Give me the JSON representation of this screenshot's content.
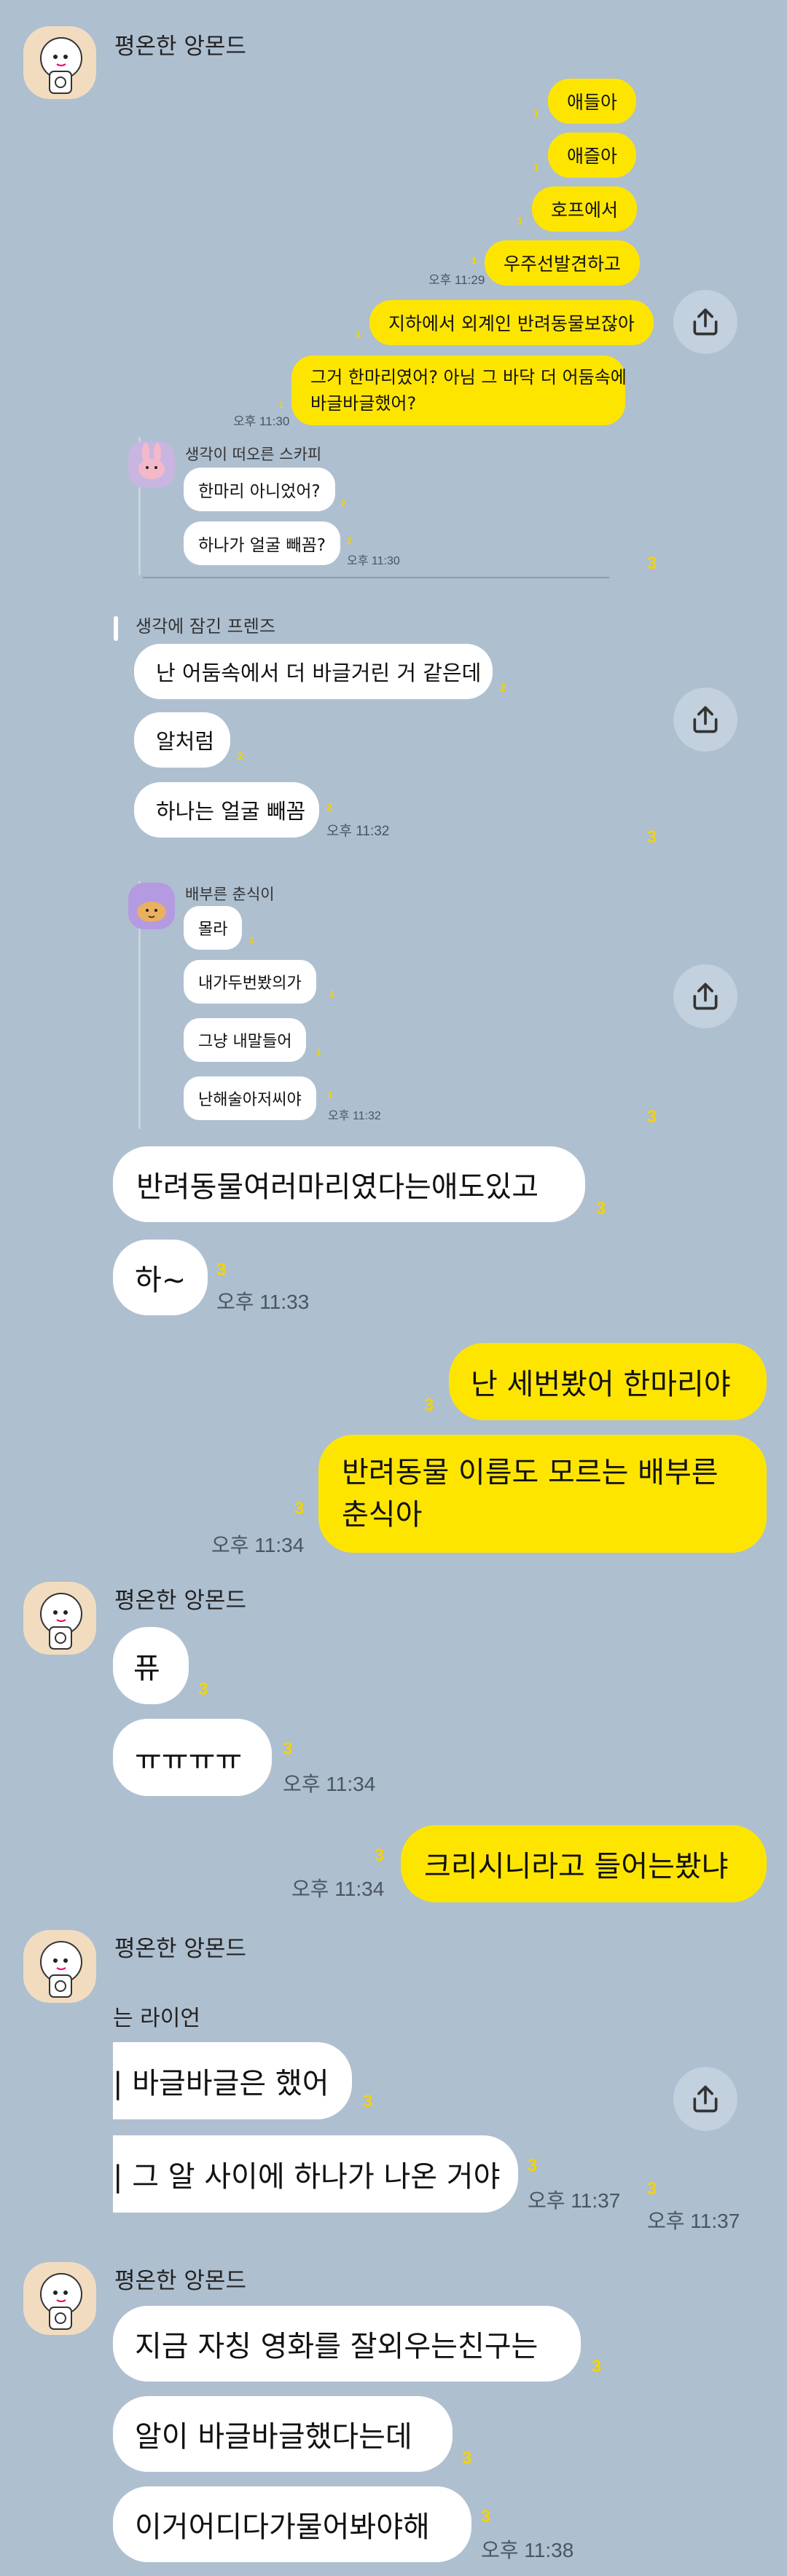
{
  "colors": {
    "background": "#aebfd0",
    "my_bubble": "#fee500",
    "their_bubble": "#ffffff",
    "unread_count": "#f4d300"
  },
  "shot1": {
    "sender": "평온한 앙몬드",
    "my_msgs": [
      "애들아",
      "애즐아",
      "호프에서",
      "우주선발견하고",
      "지하에서 외계인 반려동물보잖아",
      "그거 한마리였어? 아님 그 바닥 더 어둠속에",
      "바글바글했어?"
    ],
    "my_counts": [
      "1",
      "1",
      "1",
      "1",
      "1",
      "1"
    ],
    "time_a": "오후 11:29",
    "time_b": "오후 11:30",
    "q_sender": "생각이 떠오른 스카피",
    "q_msgs": [
      "한마리 아니었어?",
      "하나가 얼굴 빼꼼?"
    ],
    "q_counts": [
      "2",
      "2"
    ],
    "q_time": "오후 11:30",
    "count": "3"
  },
  "shot2": {
    "sender": "생각에 잠긴 프렌즈",
    "msgs": [
      "난 어둠속에서 더 바글거린 거 같은데",
      "알처럼",
      "하나는 얼굴 빼꼼"
    ],
    "counts": [
      "2",
      "2",
      "2"
    ],
    "time": "오후 11:32",
    "count": "3"
  },
  "shot3": {
    "sender": "배부른 춘식이",
    "msgs": [
      "몰라",
      "내가두번봤의가",
      "그냥 내말들어",
      "난해술아저씨야"
    ],
    "counts": [
      "1",
      "1",
      "1",
      "1"
    ],
    "time": "오후 11:32",
    "count": "3"
  },
  "shot4": {
    "msgs": [
      "반려동물여러마리였다는애도있고",
      "하~"
    ],
    "counts": [
      "3",
      "3"
    ],
    "time": "오후 11:33"
  },
  "shot5": {
    "msgs": [
      "난 세번봤어 한마리야",
      "반려동물 이름도 모르는 배부른",
      "춘식아"
    ],
    "counts": [
      "3",
      "3"
    ],
    "time": "오후 11:34"
  },
  "shot6": {
    "sender": "평온한 앙몬드",
    "msgs": [
      "퓨",
      "ㅠㅠㅠㅠ"
    ],
    "counts": [
      "3",
      "3"
    ],
    "time": "오후 11:34"
  },
  "shot7": {
    "msg": "크리시니라고 들어는봤냐",
    "count": "3",
    "time": "오후 11:34"
  },
  "shot8": {
    "sender": "평온한 앙몬드",
    "inner_sender": "는 라이언",
    "msgs": [
      "| 바글바글은 했어",
      "| 그 알 사이에 하나가 나온 거야"
    ],
    "counts": [
      "3",
      "3"
    ],
    "inner_time": "오후 11:37",
    "outer_count": "3",
    "outer_time": "오후 11:37"
  },
  "shot9": {
    "sender": "평온한 앙몬드",
    "msgs": [
      "지금 자칭 영화를 잘외우는친구는",
      "알이 바글바글했다는데",
      "이거어디다가물어봐야해"
    ],
    "counts": [
      "3",
      "3",
      "3"
    ],
    "time": "오후 11:38"
  },
  "icons": {
    "avatar": "sticker-character-avatar",
    "share": "share-upload-icon"
  }
}
